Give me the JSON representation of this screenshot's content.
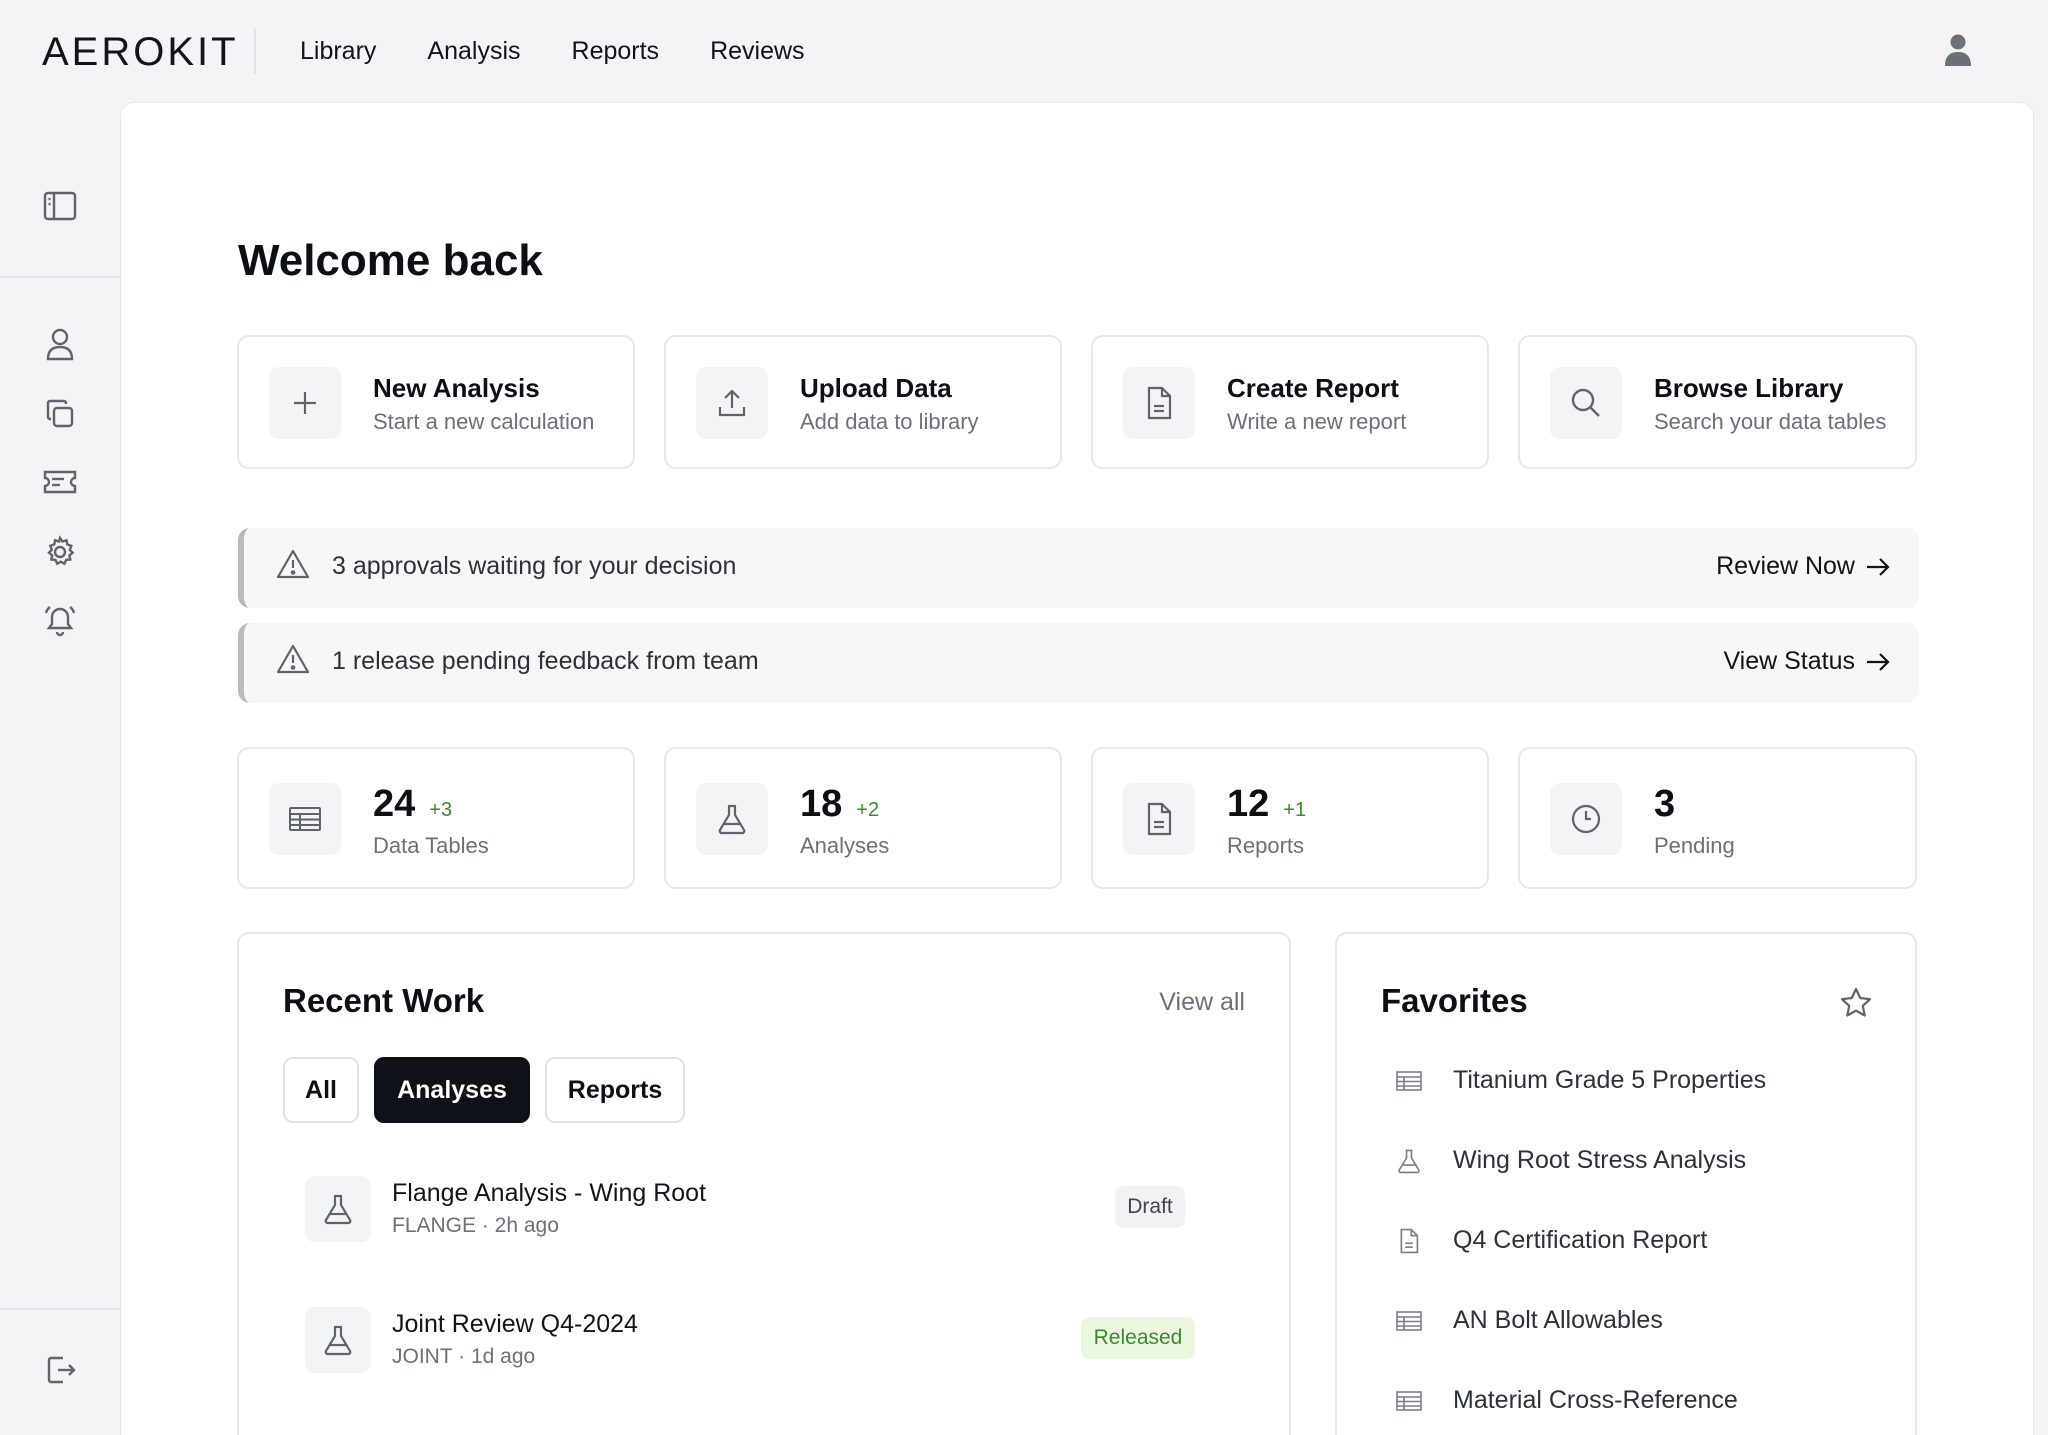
{
  "app": {
    "logo_text": "AEROKIT",
    "nav": [
      "Library",
      "Analysis",
      "Reports",
      "Reviews"
    ]
  },
  "icons": {
    "rail": [
      "sidebar-toggle-icon",
      "user-icon",
      "copy-icon",
      "ticket-icon",
      "gear-icon",
      "bell-icon",
      "logout-icon"
    ]
  },
  "page": {
    "title": "Welcome back"
  },
  "quick_actions": [
    {
      "title": "New Analysis",
      "subtitle": "Start a new calculation",
      "icon": "plus-icon"
    },
    {
      "title": "Upload Data",
      "subtitle": "Add data to library",
      "icon": "upload-icon"
    },
    {
      "title": "Create Report",
      "subtitle": "Write a new report",
      "icon": "document-icon"
    },
    {
      "title": "Browse Library",
      "subtitle": "Search your data tables",
      "icon": "search-icon"
    }
  ],
  "alerts": [
    {
      "text": "3 approvals waiting for your decision",
      "action": "Review Now"
    },
    {
      "text": "1 release pending feedback from team",
      "action": "View Status"
    }
  ],
  "stats": [
    {
      "value": "24",
      "delta": "+3",
      "label": "Data Tables",
      "icon": "table-icon"
    },
    {
      "value": "18",
      "delta": "+2",
      "label": "Analyses",
      "icon": "flask-icon"
    },
    {
      "value": "12",
      "delta": "+1",
      "label": "Reports",
      "icon": "document-icon"
    },
    {
      "value": "3",
      "delta": "",
      "label": "Pending",
      "icon": "clock-icon"
    }
  ],
  "recent_work": {
    "title": "Recent Work",
    "view_all": "View all",
    "filters": [
      "All",
      "Analyses",
      "Reports"
    ],
    "active_filter": "Analyses",
    "items": [
      {
        "name": "Flange Analysis - Wing Root",
        "meta": "FLANGE · 2h ago",
        "status": "Draft"
      },
      {
        "name": "Joint Review Q4-2024",
        "meta": "JOINT · 1d ago",
        "status": "Released"
      }
    ]
  },
  "favorites": {
    "title": "Favorites",
    "items": [
      {
        "name": "Titanium Grade 5 Properties",
        "icon": "table-icon"
      },
      {
        "name": "Wing Root Stress Analysis",
        "icon": "flask-icon"
      },
      {
        "name": "Q4 Certification Report",
        "icon": "document-icon"
      },
      {
        "name": "AN Bolt Allowables",
        "icon": "table-icon"
      },
      {
        "name": "Material Cross-Reference",
        "icon": "table-icon"
      }
    ]
  },
  "colors": {
    "accent_dark": "#0e1118",
    "positive": "#3c8a2e",
    "released_bg": "#ebf8df",
    "muted_text": "#6b7079"
  }
}
